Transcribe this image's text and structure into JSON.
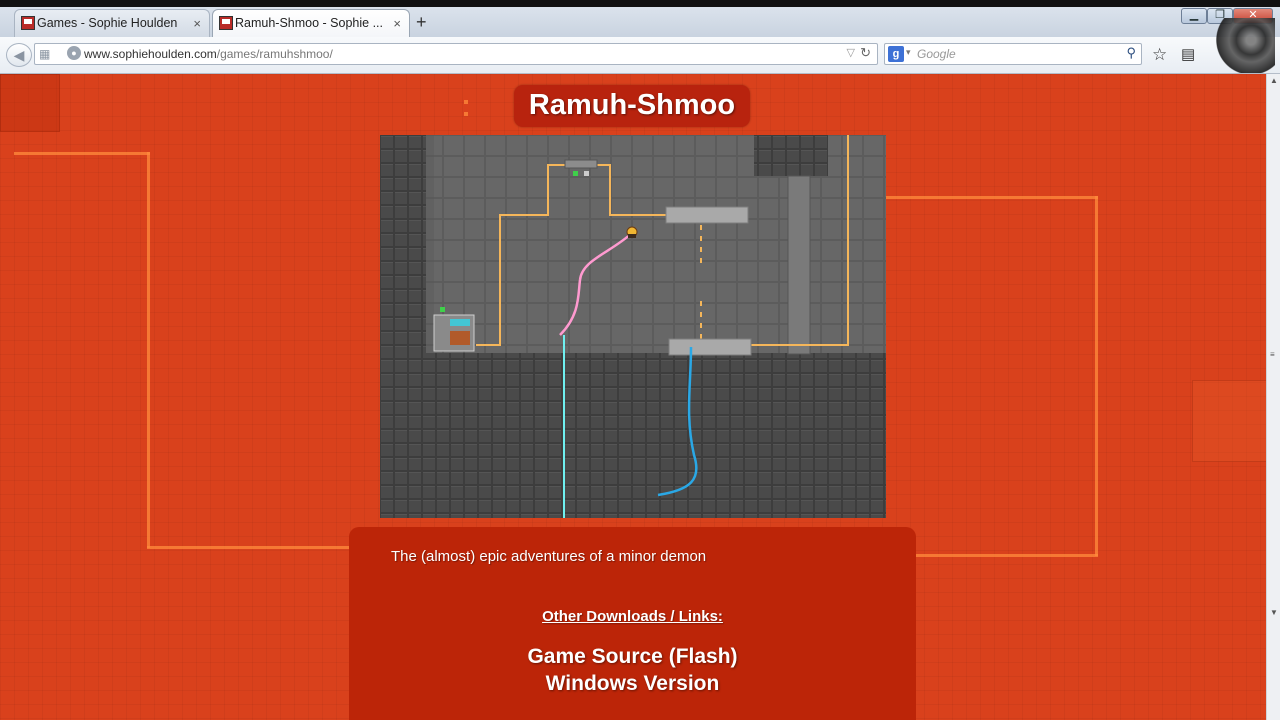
{
  "browser": {
    "tabs": [
      {
        "label": "Games - Sophie Houlden",
        "close": "×"
      },
      {
        "label": "Ramuh-Shmoo - Sophie ...",
        "close": "×"
      }
    ],
    "new_tab": "+",
    "window_controls": {
      "minimize": "▁",
      "restore": "❐",
      "close": "✕"
    },
    "url": {
      "domain": "www.sophiehoulden.com",
      "path": "/games/ramuhshmoo/"
    },
    "search": {
      "engine_letter": "g",
      "placeholder": "Google"
    },
    "icons": {
      "back": "arrow-left-icon",
      "reload": "reload-icon",
      "search": "magnifier-icon",
      "bookmark": "star-icon",
      "reader": "clipboard-icon"
    }
  },
  "page": {
    "title": "Ramuh-Shmoo",
    "description": "The (almost) epic adventures of a minor demon",
    "links_heading": "Other Downloads / Links:",
    "links": [
      "Game Source (Flash)",
      "Windows Version"
    ]
  },
  "game": {
    "level_elements": [
      "wall-tiles",
      "platforms",
      "wires",
      "character",
      "pink-trail",
      "blue-trail",
      "cyan-beam",
      "control-panel"
    ]
  },
  "colors": {
    "page_bg": "#d9411c",
    "panel_bg": "#bc2508",
    "wire": "#f5b65a",
    "pink_trail": "#ff9ad0",
    "blue_trail": "#2aa8e6",
    "cyan_beam": "#6ff0f0"
  }
}
